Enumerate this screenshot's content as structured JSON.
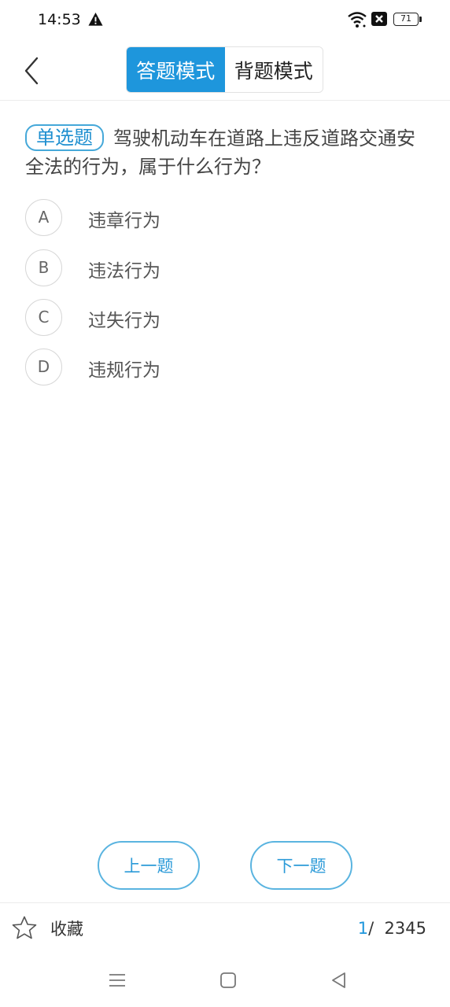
{
  "status_bar": {
    "time": "14:53",
    "battery": "71"
  },
  "header": {
    "back_icon": "chevron-left-icon",
    "modes": [
      {
        "label": "答题模式",
        "active": true
      },
      {
        "label": "背题模式",
        "active": false
      }
    ]
  },
  "question": {
    "type_label": "单选题",
    "text": "驾驶机动车在道路上违反道路交通安全法的行为，属于什么行为？"
  },
  "options": [
    {
      "letter": "A",
      "text": "违章行为"
    },
    {
      "letter": "B",
      "text": "违法行为"
    },
    {
      "letter": "C",
      "text": "过失行为"
    },
    {
      "letter": "D",
      "text": "违规行为"
    }
  ],
  "nav": {
    "prev_label": "上一题",
    "next_label": "下一题"
  },
  "footer": {
    "favorite_label": "收藏",
    "current": "1",
    "separator": "/",
    "total": "2345"
  },
  "colors": {
    "accent": "#1e96dc",
    "badge_border": "#45a8d9",
    "button_border": "#5ab4e0"
  }
}
